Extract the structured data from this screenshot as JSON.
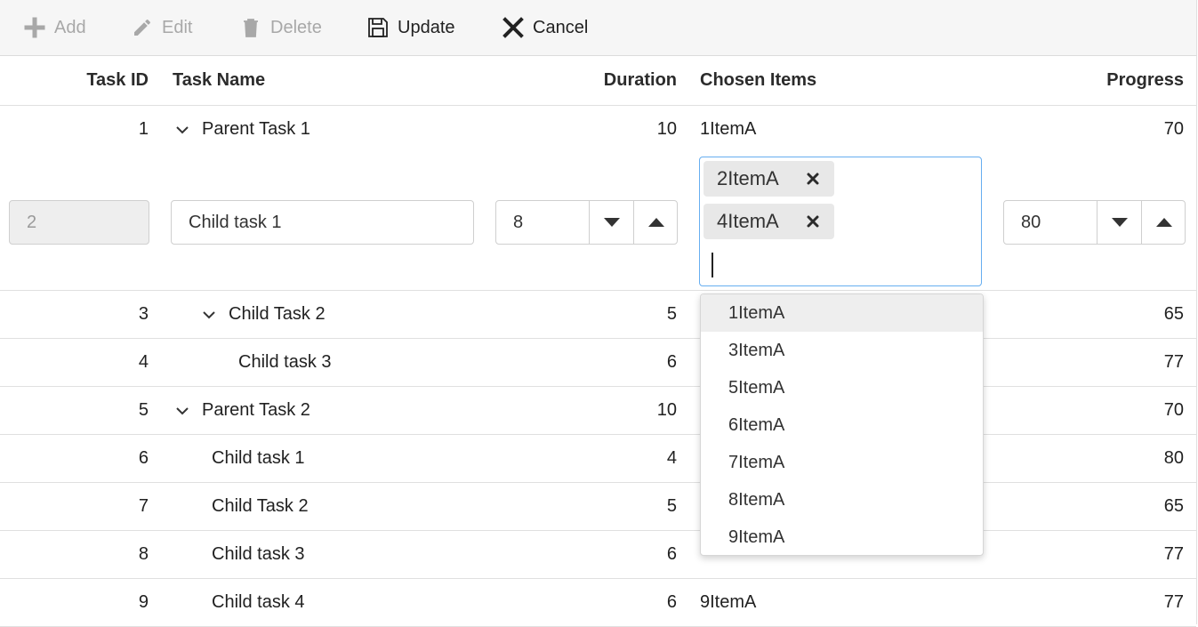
{
  "toolbar": {
    "add": "Add",
    "edit": "Edit",
    "delete": "Delete",
    "update": "Update",
    "cancel": "Cancel"
  },
  "columns": {
    "task_id": "Task ID",
    "task_name": "Task Name",
    "duration": "Duration",
    "chosen_items": "Chosen Items",
    "progress": "Progress"
  },
  "rows": [
    {
      "id": "1",
      "name": "Parent Task 1",
      "duration": "10",
      "items": "1ItemA",
      "progress": "70"
    },
    {
      "id": "3",
      "name": "Child Task 2",
      "duration": "5",
      "items": "",
      "progress": "65"
    },
    {
      "id": "4",
      "name": "Child task 3",
      "duration": "6",
      "items": "",
      "progress": "77"
    },
    {
      "id": "5",
      "name": "Parent Task 2",
      "duration": "10",
      "items": "",
      "progress": "70"
    },
    {
      "id": "6",
      "name": "Child task 1",
      "duration": "4",
      "items": "",
      "progress": "80"
    },
    {
      "id": "7",
      "name": "Child Task 2",
      "duration": "5",
      "items": "",
      "progress": "65"
    },
    {
      "id": "8",
      "name": "Child task 3",
      "duration": "6",
      "items": "",
      "progress": "77"
    },
    {
      "id": "9",
      "name": "Child task 4",
      "duration": "6",
      "items": "9ItemA",
      "progress": "77"
    }
  ],
  "edit_row": {
    "task_id": "2",
    "task_name": "Child task 1",
    "duration": "8",
    "chips": [
      "2ItemA",
      "4ItemA"
    ],
    "progress": "80"
  },
  "dropdown": {
    "options": [
      "1ItemA",
      "3ItemA",
      "5ItemA",
      "6ItemA",
      "7ItemA",
      "8ItemA",
      "9ItemA"
    ],
    "hovered": "1ItemA"
  },
  "colors": {
    "focus_border": "#67aef0",
    "disabled_text": "#a8a8a8",
    "chip_bg": "#e8e8e8"
  }
}
